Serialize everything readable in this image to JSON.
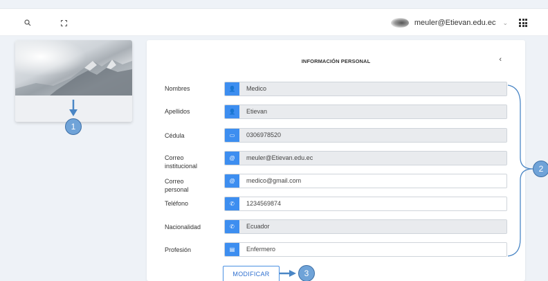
{
  "topbar": {
    "search_icon": "search-icon",
    "fullscreen_icon": "fullscreen-icon",
    "user_email": "meuler@Etievan.edu.ec",
    "caret": "⌄",
    "apps_icon": "grid-icon"
  },
  "section": {
    "title": "INFORMACIÓN PERSONAL",
    "collapse": "‹"
  },
  "fields": [
    {
      "label": "Nombres",
      "value": "Medico",
      "icon": "user-icon",
      "glyph": "👤",
      "readonly": true
    },
    {
      "label": "Apellidos",
      "value": "Etievan",
      "icon": "user-icon",
      "glyph": "👤",
      "readonly": true
    },
    {
      "label": "Cédula",
      "value": "0306978520",
      "icon": "id-card-icon",
      "glyph": "▭",
      "readonly": true
    },
    {
      "label": "Correo institucional",
      "value": "meuler@Etievan.edu.ec",
      "icon": "at-icon",
      "glyph": "@",
      "readonly": true
    },
    {
      "label": "Correo personal",
      "value": "medico@gmail.com",
      "icon": "at-icon",
      "glyph": "@",
      "readonly": false
    },
    {
      "label": "Teléfono",
      "value": "1234569874",
      "icon": "phone-icon",
      "glyph": "✆",
      "readonly": false
    },
    {
      "label": "Nacionalidad",
      "value": "Ecuador",
      "icon": "phone-icon",
      "glyph": "✆",
      "readonly": true
    },
    {
      "label": "Profesión",
      "value": "Enfermero",
      "icon": "document-icon",
      "glyph": "▤",
      "readonly": false
    }
  ],
  "button": {
    "label": "MODIFICAR"
  },
  "annotations": [
    "1",
    "2",
    "3"
  ],
  "colors": {
    "accent": "#3d8ef0",
    "badge": "#6fa3d8",
    "readonly_bg": "#e9ebee"
  }
}
